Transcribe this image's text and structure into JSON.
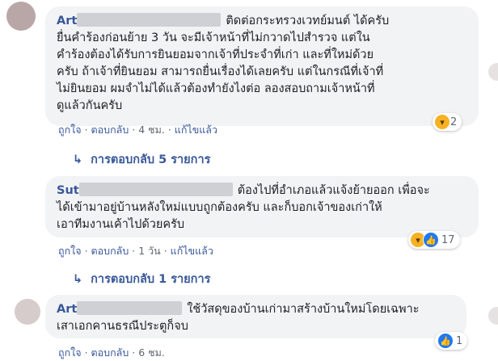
{
  "comments": [
    {
      "name": "Art",
      "text": "ติดต่อกระทรวงเวทย์มนต์ ได้ครับ ยื่นคำร้องก่อนย้าย 3 วัน จะมีเจ้าหน้าที่ไม่กวาดไปสำรวจ แต่ในคำร้องต้องได้รับการยินยอมจากเจ้าที่ประจำที่เก่า และที่ใหม่ด้วย ครับ ถ้าเจ้าที่ยินยอม สามารถยื่นเรื่องได้เลยครับ แต่ในกรณีที่เจ้าที่ไม่ยินยอม ผมจำไม่ได้แล้วต้องทำยังไงต่อ ลองสอบถามเจ้าหน้าที่ดูแล้วกันครับ",
      "lines": [
        "ติดต่อกระทรวงเวทย์มนต์ ได้ครับ",
        "ยื่นคำร้องก่อนย้าย 3 วัน จะมีเจ้าหน้าที่ไม่กวาดไปสำรวจ แต่ใน",
        "คำร้องต้องได้รับการยินยอมจากเจ้าที่ประจำที่เก่า และที่ใหม่ด้วย",
        "ครับ ถ้าเจ้าที่ยินยอม สามารถยื่นเรื่องได้เลยครับ แต่ในกรณีที่เจ้าที่",
        "ไม่ยินยอม ผมจำไม่ได้แล้วต้องทำยังไงต่อ ลองสอบถามเจ้าหน้าที่",
        "ดูแล้วกันครับ"
      ],
      "like": "ถูกใจ",
      "reply": "ตอบกลับ",
      "time": "4 ชม.",
      "edited": "แก้ไขแล้ว",
      "reaction_count": "2",
      "replies_label": "การตอบกลับ 5 รายการ"
    },
    {
      "name": "Sut",
      "lines": [
        "ต้องไปที่อำเภอแล้วแจ้งย้ายออก เพื่อจะ",
        "ได้เข้ามาอยู่บ้านหลังใหม่แบบถูกต้องครับ และก็บอกเจ้าของเก่าให้",
        "เอาทีมงานเค้าไปด้วยครับ"
      ],
      "like": "ถูกใจ",
      "reply": "ตอบกลับ",
      "time": "1 วัน",
      "edited": "แก้ไขแล้ว",
      "reaction_count": "17",
      "replies_label": "การตอบกลับ 1 รายการ"
    },
    {
      "name": "Art",
      "lines": [
        "ใช้วัสดุของบ้านเก่ามาสร้างบ้านใหม่โดยเฉพาะ",
        "เสาเอกคานธรณีประตูก็จบ"
      ],
      "like": "ถูกใจ",
      "reply": "ตอบกลับ",
      "time": "6 ชม.",
      "reaction_count": "1"
    }
  ],
  "separator": "·",
  "colors": {
    "link": "#385898",
    "bubble": "#f2f3f5",
    "meta": "#606770"
  }
}
